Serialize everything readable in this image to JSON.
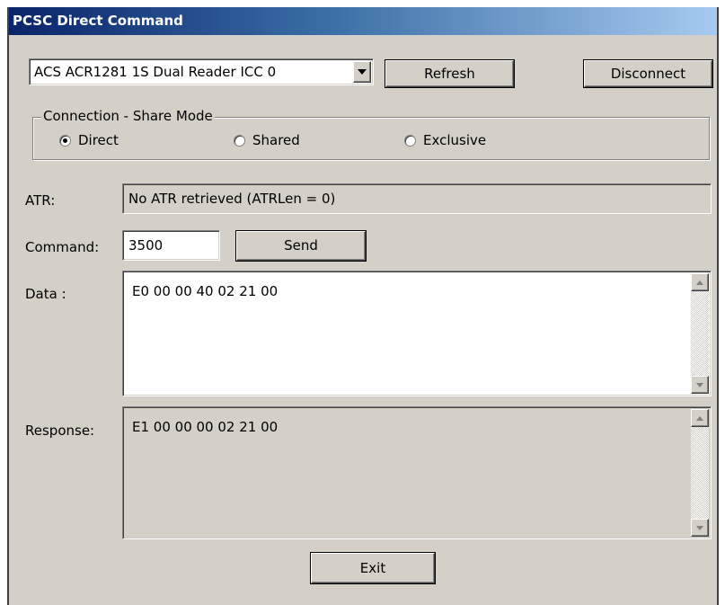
{
  "window": {
    "title": "PCSC Direct Command"
  },
  "reader": {
    "selected": "ACS ACR1281 1S Dual Reader ICC 0",
    "dropdown_icon": "triangle-down-icon"
  },
  "buttons": {
    "refresh": "Refresh",
    "disconnect": "Disconnect",
    "send": "Send",
    "exit": "Exit"
  },
  "connection": {
    "group_label": "Connection - Share Mode",
    "options": [
      {
        "label": "Direct",
        "checked": true
      },
      {
        "label": "Shared",
        "checked": false
      },
      {
        "label": "Exclusive",
        "checked": false
      }
    ]
  },
  "atr": {
    "label": "ATR:",
    "value": "No ATR retrieved (ATRLen = 0)"
  },
  "command": {
    "label": "Command:",
    "value": "3500"
  },
  "data": {
    "label": "Data :",
    "value": "E0 00 00 40 02 21 00"
  },
  "response": {
    "label": "Response:",
    "value": "E1 00 00 00 02 21 00"
  }
}
